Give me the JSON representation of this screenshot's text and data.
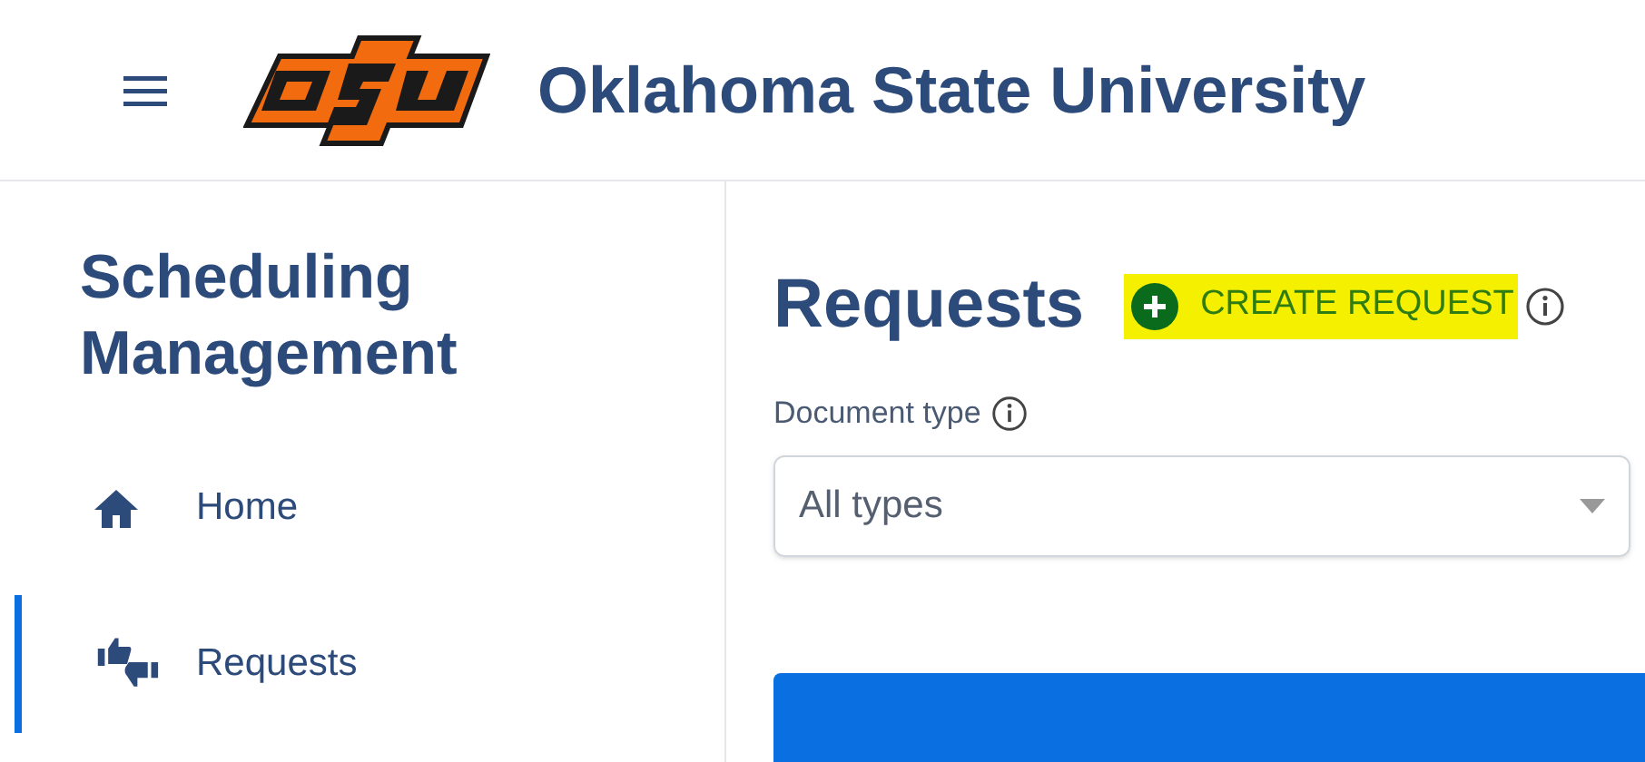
{
  "header": {
    "title": "Oklahoma State University"
  },
  "sidebar": {
    "title": "Scheduling Management",
    "items": [
      {
        "label": "Home",
        "kind": "home",
        "selected": false
      },
      {
        "label": "Requests",
        "kind": "requests",
        "selected": true
      }
    ]
  },
  "main": {
    "heading": "Requests",
    "create_button": {
      "label": "CREATE REQUEST",
      "highlighted": true
    },
    "document_type": {
      "label": "Document type",
      "value": "All types"
    }
  }
}
